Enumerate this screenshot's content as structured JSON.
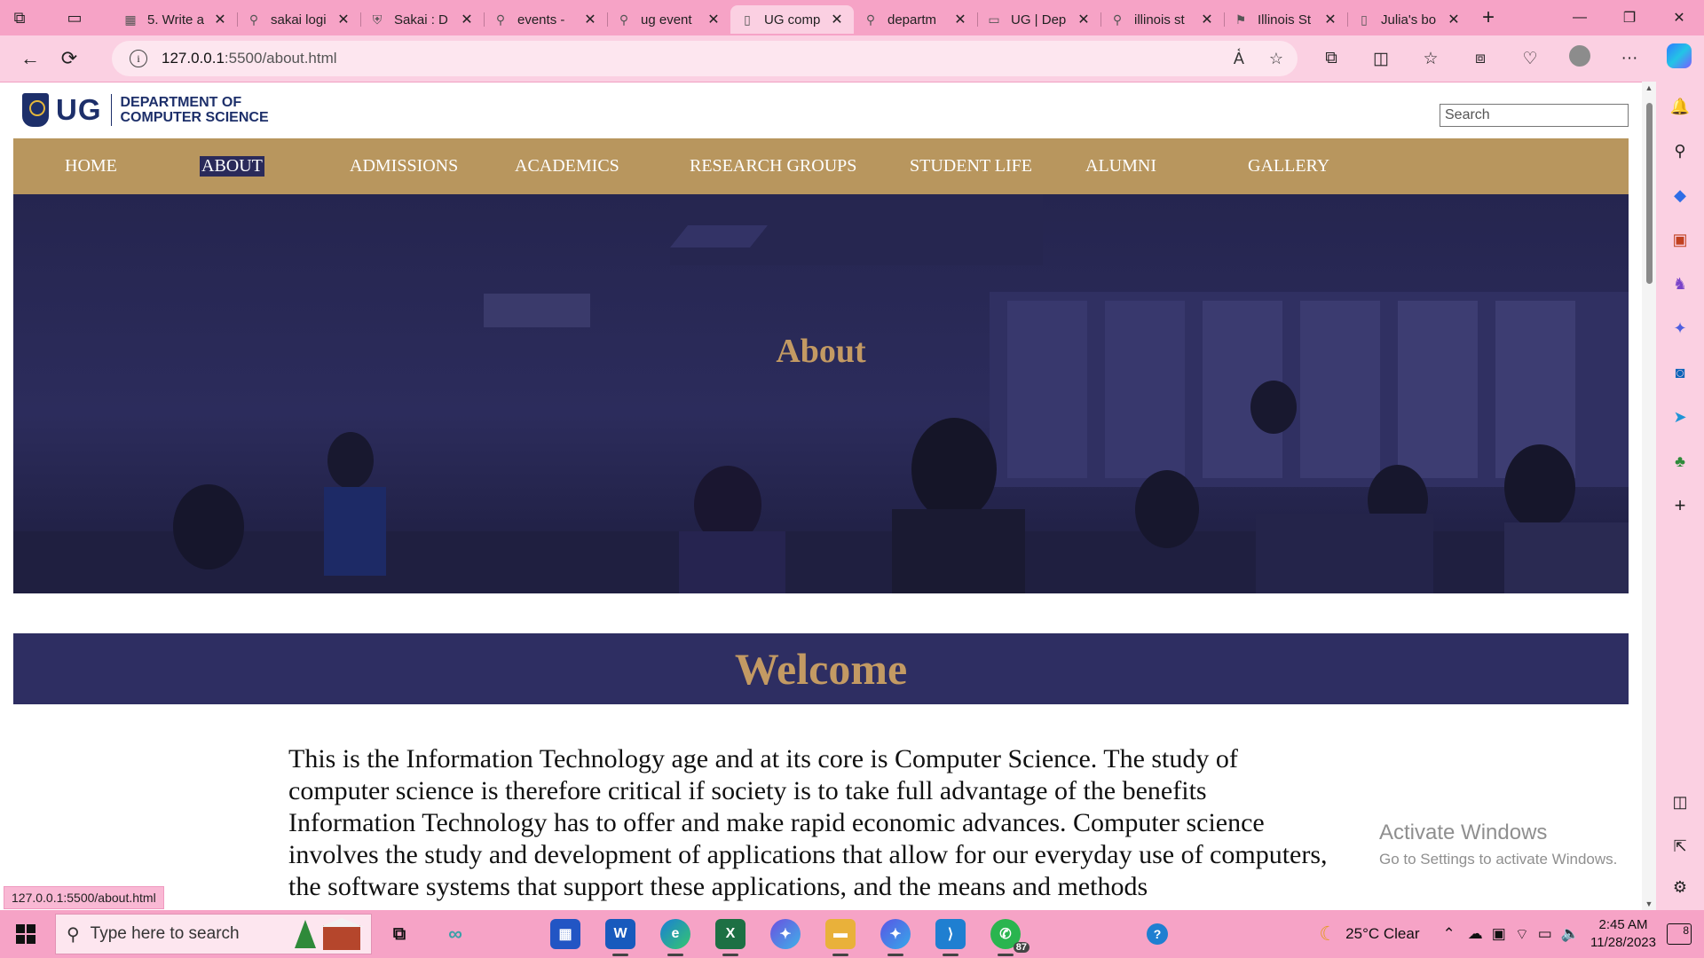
{
  "browser": {
    "tabs": [
      {
        "label": "5. Write a",
        "icon": "mortarboard-icon"
      },
      {
        "label": "sakai logi",
        "icon": "search-icon"
      },
      {
        "label": "Sakai : D",
        "icon": "shield-icon"
      },
      {
        "label": "events -",
        "icon": "search-icon"
      },
      {
        "label": "ug event",
        "icon": "search-icon"
      },
      {
        "label": "UG comp",
        "icon": "page-icon",
        "active": true
      },
      {
        "label": "departm",
        "icon": "search-icon"
      },
      {
        "label": "UG | Dep",
        "icon": "site-icon"
      },
      {
        "label": "illinois st",
        "icon": "search-icon"
      },
      {
        "label": "Illinois St",
        "icon": "flag-icon"
      },
      {
        "label": "Julia's bo",
        "icon": "page-icon"
      }
    ],
    "url_host": "127.0.0.1",
    "url_rest": ":5500/about.html",
    "status_url": "127.0.0.1:5500/about.html"
  },
  "site": {
    "logo_ug": "UG",
    "logo_line1": "DEPARTMENT OF",
    "logo_line2": "COMPUTER SCIENCE",
    "search_placeholder": "Search",
    "nav": [
      {
        "label": "HOME"
      },
      {
        "label": "ABOUT",
        "active": true
      },
      {
        "label": "ADMISSIONS"
      },
      {
        "label": "ACADEMICS"
      },
      {
        "label": "RESEARCH GROUPS"
      },
      {
        "label": "STUDENT LIFE"
      },
      {
        "label": "ALUMNI"
      },
      {
        "label": "GALLERY"
      }
    ],
    "hero_title": "About",
    "welcome": "Welcome",
    "intro": "This is the Information Technology age and at its core is Computer Science. The study of computer science is therefore critical if society is to take full advantage of the benefits Information Technology has to offer and make rapid economic advances. Computer science involves the study and development of applications that allow for our everyday use of computers, the software systems that support these applications, and the means and methods"
  },
  "watermark": {
    "line1": "Activate Windows",
    "line2": "Go to Settings to activate Windows."
  },
  "taskbar": {
    "search_placeholder": "Type here to search",
    "whatsapp_badge": "87",
    "weather": "25°C  Clear",
    "time": "2:45 AM",
    "date": "11/28/2023",
    "notifications": "8"
  },
  "colors": {
    "nav_bg": "#b8965e",
    "accent_gold": "#c39a63",
    "navy": "#2e2e62",
    "browser_pink": "#f6a3c6"
  }
}
